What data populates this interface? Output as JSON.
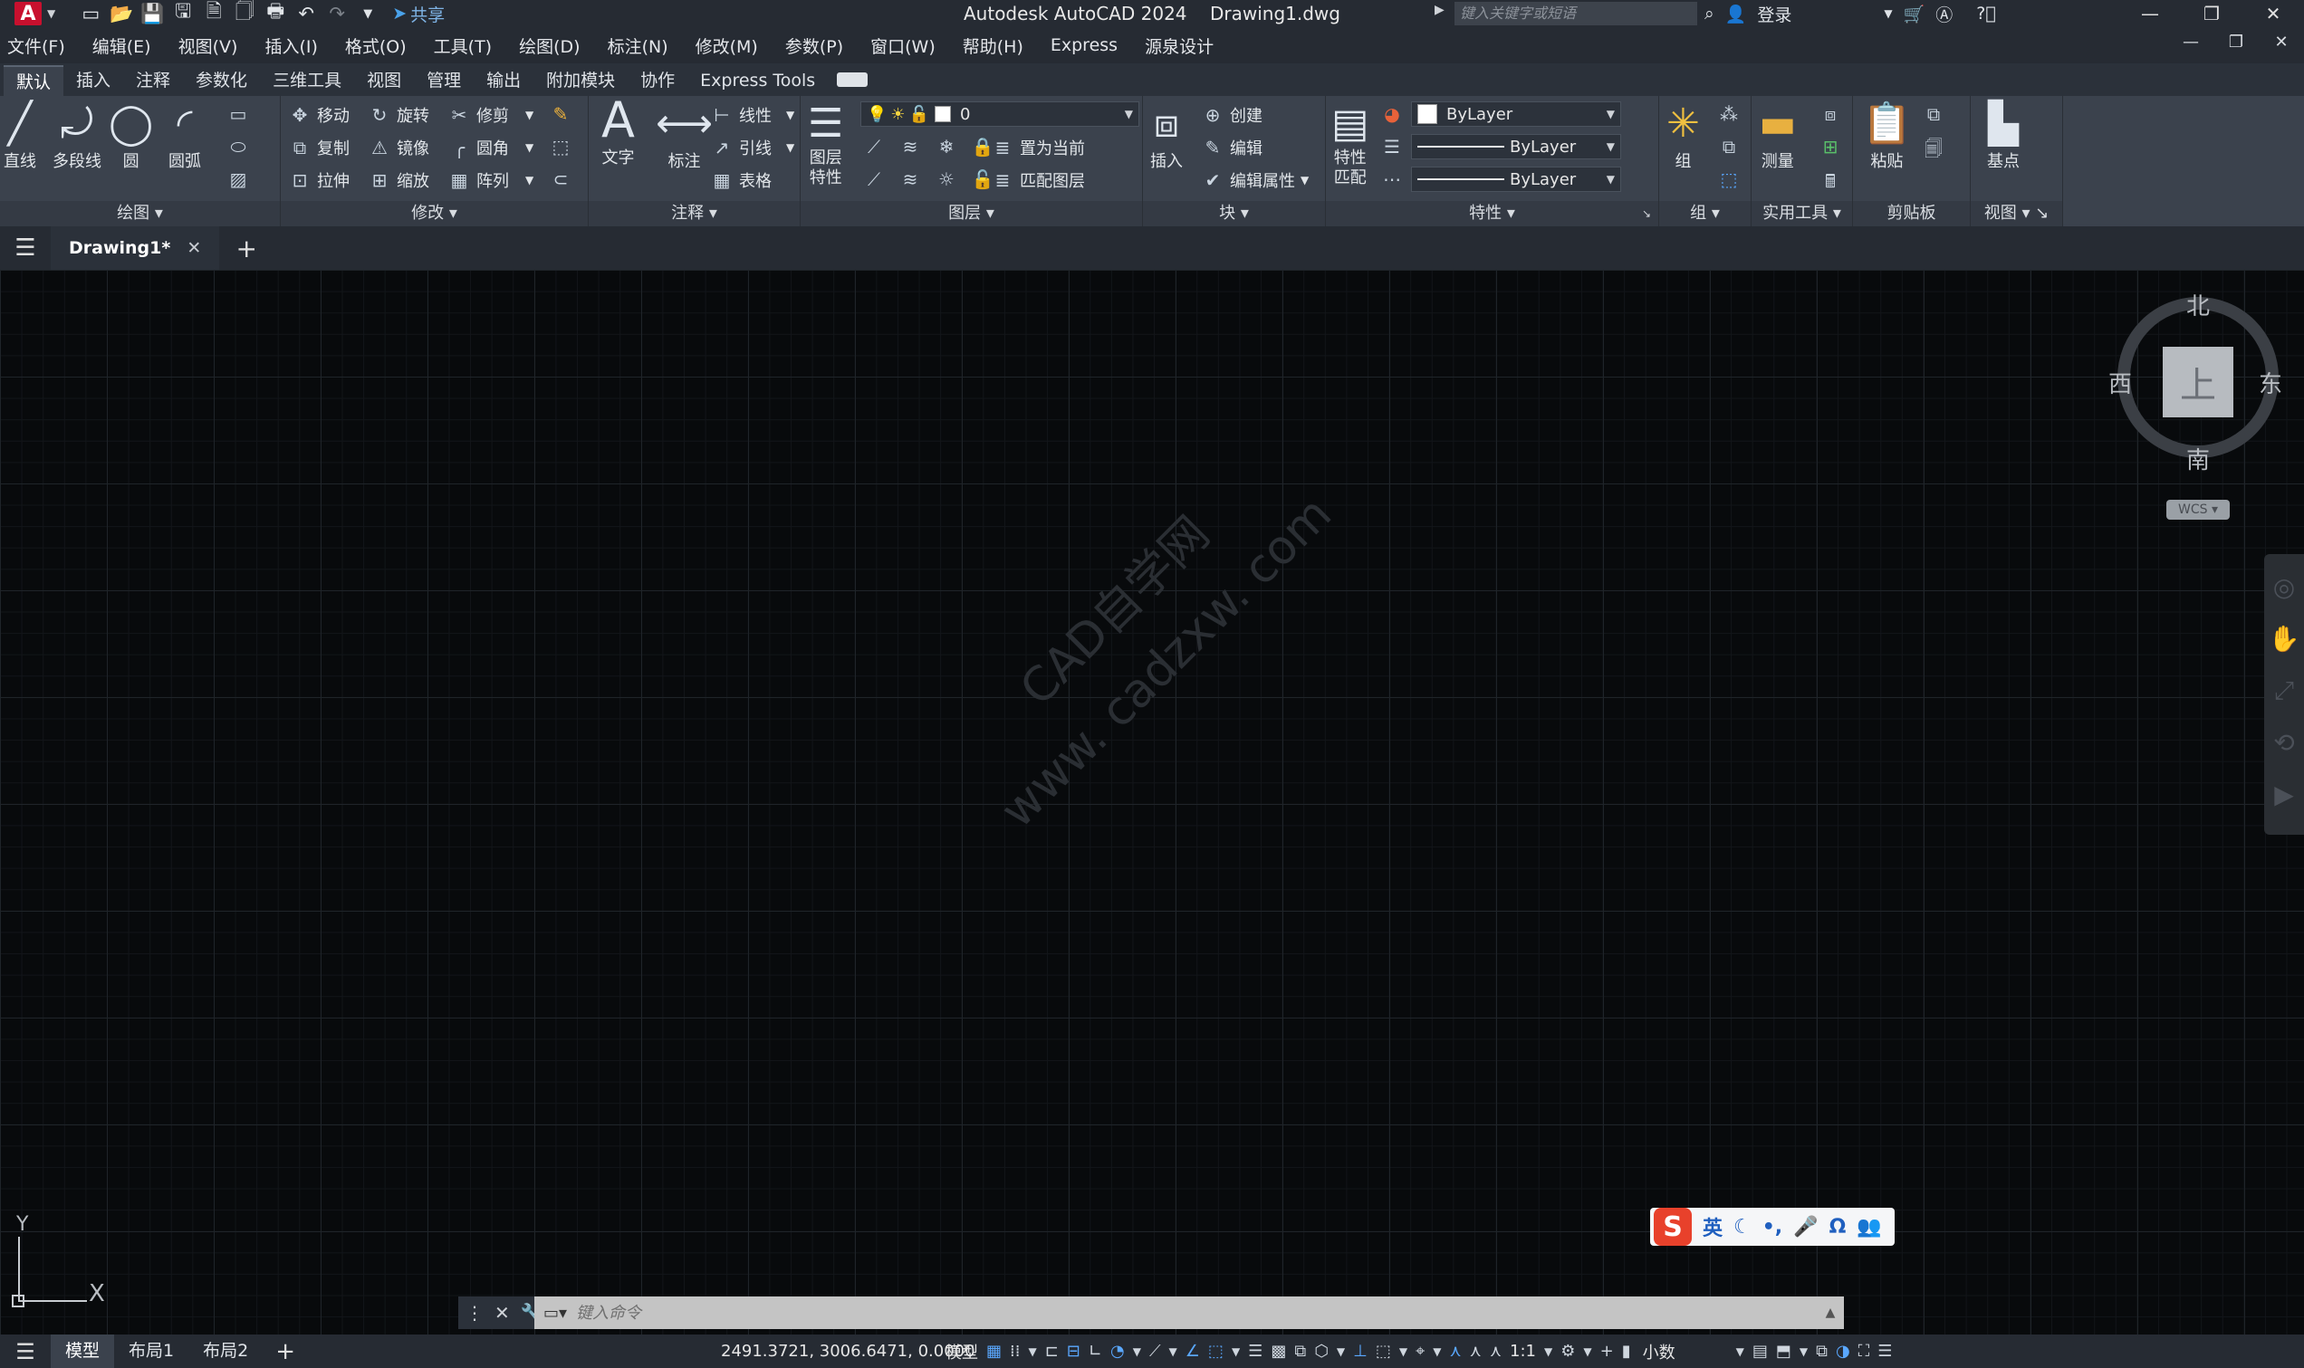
{
  "titlebar": {
    "logo": "A",
    "share": "共享",
    "app_title": "Autodesk AutoCAD 2024",
    "doc_title": "Drawing1.dwg",
    "search_placeholder": "键入关键字或短语",
    "login": "登录",
    "icons": [
      "new-icon",
      "open-icon",
      "save-icon",
      "save-as-icon",
      "publish-icon",
      "plot-preview-icon",
      "print-icon",
      "undo-icon",
      "redo-icon"
    ]
  },
  "menu": [
    "文件(F)",
    "编辑(E)",
    "视图(V)",
    "插入(I)",
    "格式(O)",
    "工具(T)",
    "绘图(D)",
    "标注(N)",
    "修改(M)",
    "参数(P)",
    "窗口(W)",
    "帮助(H)",
    "Express",
    "源泉设计"
  ],
  "ribbon_tabs": [
    "默认",
    "插入",
    "注释",
    "参数化",
    "三维工具",
    "视图",
    "管理",
    "输出",
    "附加模块",
    "协作",
    "Express Tools"
  ],
  "ribbon": {
    "draw": {
      "title": "绘图",
      "line": "直线",
      "polyline": "多段线",
      "circle": "圆",
      "arc": "圆弧"
    },
    "modify": {
      "title": "修改",
      "move": "移动",
      "rotate": "旋转",
      "trim": "修剪",
      "copy": "复制",
      "mirror": "镜像",
      "fillet": "圆角",
      "stretch": "拉伸",
      "scale": "缩放",
      "array": "阵列"
    },
    "annotation": {
      "title": "注释",
      "text": "文字",
      "dimension": "标注",
      "linear": "线性",
      "leader": "引线",
      "table": "表格"
    },
    "layers": {
      "title": "图层",
      "props": "图层\n特性",
      "current_layer": "0",
      "set_current": "置为当前",
      "match": "匹配图层"
    },
    "block": {
      "title": "块",
      "insert": "插入",
      "create": "创建",
      "edit": "编辑",
      "edit_attr": "编辑属性"
    },
    "properties": {
      "title": "特性",
      "match": "特性\n匹配",
      "color": "ByLayer",
      "linetype": "ByLayer",
      "lineweight": "ByLayer"
    },
    "groups": {
      "title": "组",
      "group": "组"
    },
    "utilities": {
      "title": "实用工具",
      "measure": "测量"
    },
    "clipboard": {
      "title": "剪贴板",
      "paste": "粘贴"
    },
    "view": {
      "title": "视图",
      "base": "基点"
    }
  },
  "doc_tab": {
    "name": "Drawing1*"
  },
  "viewcube": {
    "north": "北",
    "south": "南",
    "east": "东",
    "west": "西",
    "face": "上",
    "wcs": "WCS"
  },
  "watermark": {
    "line1": "CAD自学网",
    "line2": "www. cadzxw. com"
  },
  "ucs": {
    "x": "X",
    "y": "Y"
  },
  "ime": {
    "logo": "S",
    "mode": "英"
  },
  "command": {
    "placeholder": "键入命令"
  },
  "status": {
    "layouts": [
      "模型",
      "布局1",
      "布局2"
    ],
    "coords": "2491.3721, 3006.6471, 0.0000",
    "model": "模型",
    "scale": "1:1",
    "units": "小数"
  },
  "colors": {
    "accent": "#5aa8ff",
    "ime_logo": "#e8412b"
  }
}
